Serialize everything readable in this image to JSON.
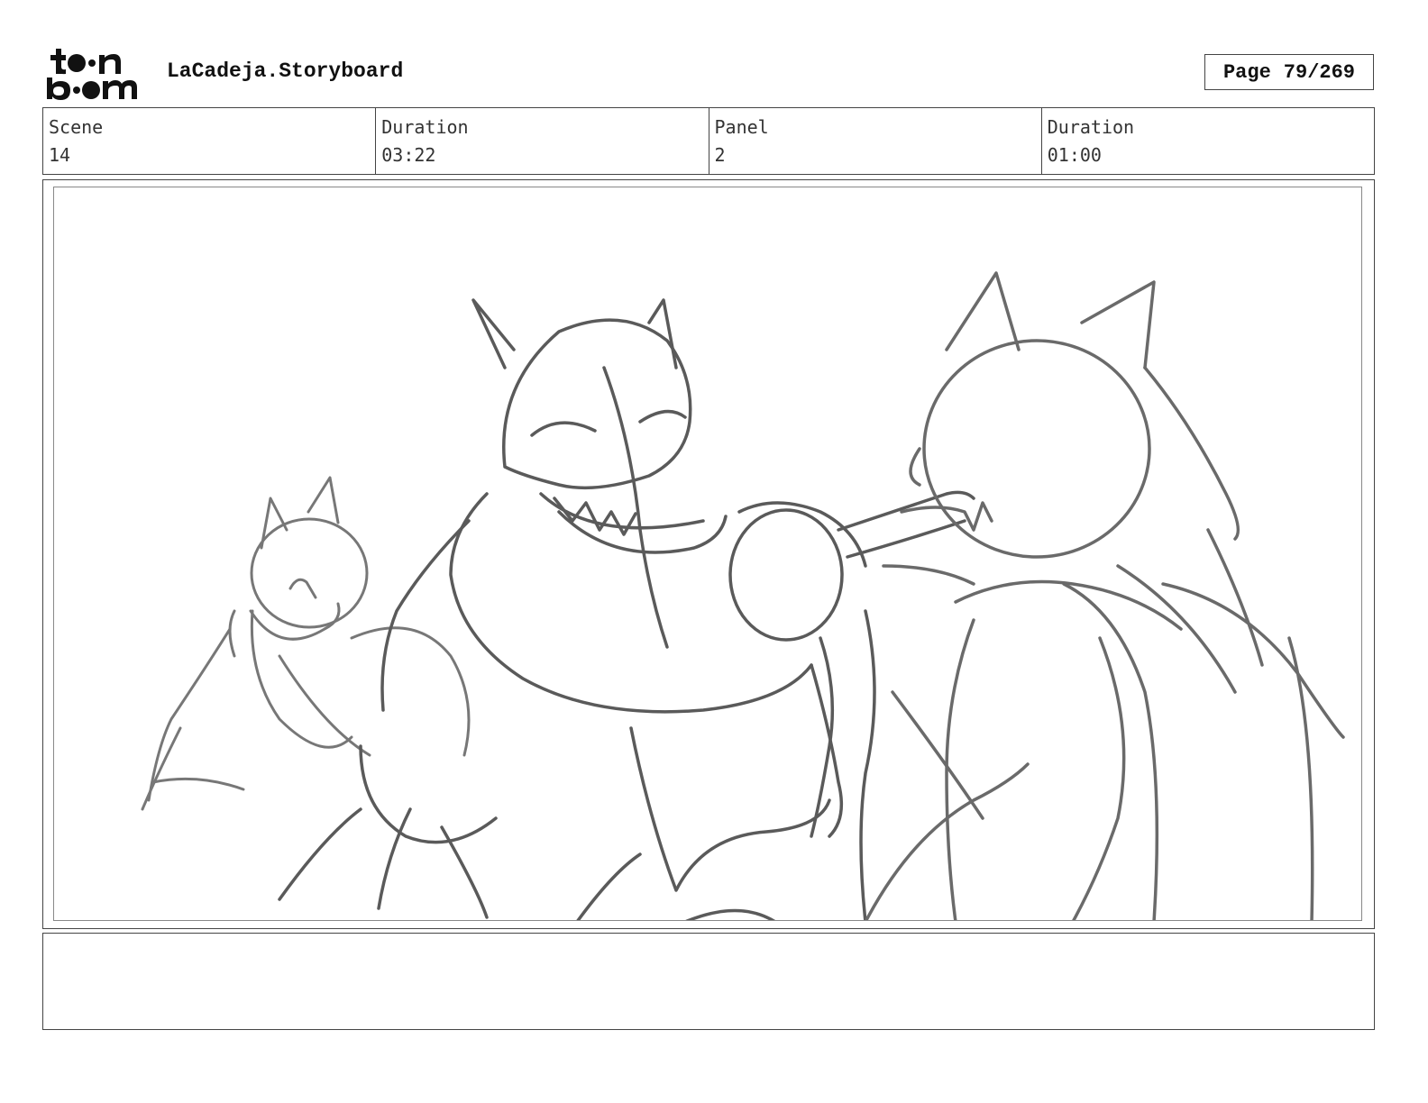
{
  "header": {
    "project_title": "LaCadeja.Storyboard",
    "page_label": "Page",
    "page_number": "79/269"
  },
  "info": {
    "scene_label": "Scene",
    "scene_value": "14",
    "scene_duration_label": "Duration",
    "scene_duration_value": "03:22",
    "panel_label": "Panel",
    "panel_value": "2",
    "panel_duration_label": "Duration",
    "panel_duration_value": "01:00"
  },
  "logo": {
    "icon": "toon-boom-logo",
    "color": "#111111"
  },
  "sketch": {
    "stroke_dark": "#555555",
    "stroke_light": "#888888"
  },
  "notes": {}
}
